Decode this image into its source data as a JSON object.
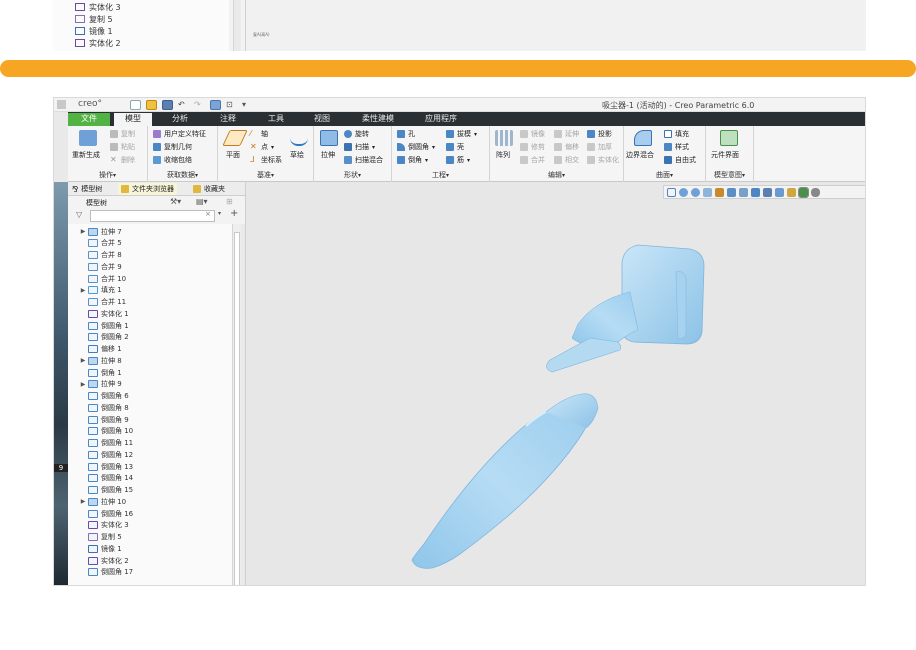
{
  "top_strip": {
    "tree_items": [
      {
        "label": "实体化 3",
        "icon": "solidify-icon",
        "color": "#6a4aa5"
      },
      {
        "label": "复制 5",
        "icon": "copy-icon",
        "color": "#8a6ab5"
      },
      {
        "label": "镜像 1",
        "icon": "mirror-icon",
        "color": "#3d6fb0"
      },
      {
        "label": "实体化 2",
        "icon": "solidify-icon",
        "color": "#6a4aa5"
      }
    ],
    "canvas_note": "复A(高A)"
  },
  "window": {
    "logo": "creo°",
    "title": "吸尘器-1 (活动的) - Creo Parametric 6.0"
  },
  "ribbon": {
    "tabs": [
      "文件",
      "模型",
      "分析",
      "注释",
      "工具",
      "视图",
      "柔性建模",
      "应用程序"
    ],
    "active_tab": "模型",
    "groups": {
      "operations": {
        "label": "操作",
        "regen": "重新生成",
        "copy": "复制",
        "paste": "粘贴",
        "delete": "删除"
      },
      "get_data": {
        "label": "获取数据",
        "udf": "用户定义特征",
        "copy_geom": "复制几何",
        "shrinkwrap": "收缩包络"
      },
      "datum": {
        "label": "基准",
        "plane": "平面",
        "axis": "轴",
        "point": "点",
        "csys": "坐标系",
        "sketch": "草绘"
      },
      "shapes": {
        "label": "形状",
        "extrude": "拉伸",
        "revolve": "旋转",
        "sweep": "扫描",
        "swept_blend": "扫描混合"
      },
      "engineering": {
        "label": "工程",
        "hole": "孔",
        "round": "倒圆角",
        "chamfer": "倒角",
        "draft": "拔模",
        "shell": "壳",
        "rib": "筋"
      },
      "editing": {
        "label": "编辑",
        "pattern": "阵列",
        "mirror": "镜像",
        "extend": "延伸",
        "project": "投影",
        "trim": "修剪",
        "offset": "偏移",
        "thicken": "加厚",
        "merge": "合并",
        "intersect": "相交",
        "solidify": "实体化"
      },
      "surfaces": {
        "label": "曲面",
        "boundary_blend": "边界混合",
        "fill": "填充",
        "style": "样式",
        "freestyle": "自由式"
      },
      "model_intent": {
        "label": "模型意图",
        "component_interface": "元件界面"
      }
    }
  },
  "navigator": {
    "tabs": [
      "模型树",
      "文件夹浏览器",
      "收藏夹"
    ],
    "header": "模型树",
    "filter_placeholder": "",
    "items": [
      {
        "label": "拉伸 7",
        "icon": "extrude-icon",
        "expandable": true,
        "color": "#4b86c5"
      },
      {
        "label": "合并 5",
        "icon": "merge-icon",
        "expandable": false,
        "color": "#5c8fc8"
      },
      {
        "label": "合并 8",
        "icon": "merge-icon",
        "expandable": false,
        "color": "#5c8fc8"
      },
      {
        "label": "合并 9",
        "icon": "merge-icon",
        "expandable": false,
        "color": "#5c8fc8"
      },
      {
        "label": "合并 10",
        "icon": "merge-icon",
        "expandable": false,
        "color": "#5c8fc8"
      },
      {
        "label": "填充 1",
        "icon": "fill-icon",
        "expandable": true,
        "color": "#4a9bd6"
      },
      {
        "label": "合并 11",
        "icon": "merge-icon",
        "expandable": false,
        "color": "#5c8fc8"
      },
      {
        "label": "实体化 1",
        "icon": "solidify-icon",
        "expandable": false,
        "color": "#6a4aa5"
      },
      {
        "label": "倒圆角 1",
        "icon": "round-icon",
        "expandable": false,
        "color": "#4b86c5"
      },
      {
        "label": "倒圆角 2",
        "icon": "round-icon",
        "expandable": false,
        "color": "#4b86c5"
      },
      {
        "label": "偏移 1",
        "icon": "offset-icon",
        "expandable": false,
        "color": "#3f7fb8"
      },
      {
        "label": "拉伸 8",
        "icon": "extrude-icon",
        "expandable": true,
        "color": "#4b86c5"
      },
      {
        "label": "倒角 1",
        "icon": "chamfer-icon",
        "expandable": false,
        "color": "#4b86c5"
      },
      {
        "label": "拉伸 9",
        "icon": "extrude-icon",
        "expandable": true,
        "color": "#4b86c5"
      },
      {
        "label": "倒圆角 6",
        "icon": "round-icon",
        "expandable": false,
        "color": "#4b86c5"
      },
      {
        "label": "倒圆角 8",
        "icon": "round-icon",
        "expandable": false,
        "color": "#4b86c5"
      },
      {
        "label": "倒圆角 9",
        "icon": "round-icon",
        "expandable": false,
        "color": "#4b86c5"
      },
      {
        "label": "倒圆角 10",
        "icon": "round-icon",
        "expandable": false,
        "color": "#4b86c5"
      },
      {
        "label": "倒圆角 11",
        "icon": "round-icon",
        "expandable": false,
        "color": "#4b86c5"
      },
      {
        "label": "倒圆角 12",
        "icon": "round-icon",
        "expandable": false,
        "color": "#4b86c5"
      },
      {
        "label": "倒圆角 13",
        "icon": "round-icon",
        "expandable": false,
        "color": "#4b86c5"
      },
      {
        "label": "倒圆角 14",
        "icon": "round-icon",
        "expandable": false,
        "color": "#4b86c5"
      },
      {
        "label": "倒圆角 15",
        "icon": "round-icon",
        "expandable": false,
        "color": "#4b86c5"
      },
      {
        "label": "拉伸 10",
        "icon": "extrude-icon",
        "expandable": true,
        "color": "#4b86c5"
      },
      {
        "label": "倒圆角 16",
        "icon": "round-icon",
        "expandable": false,
        "color": "#4b86c5"
      },
      {
        "label": "实体化 3",
        "icon": "solidify-icon",
        "expandable": false,
        "color": "#6a4aa5"
      },
      {
        "label": "复制 5",
        "icon": "copy-icon",
        "expandable": false,
        "color": "#8a6ab5"
      },
      {
        "label": "镜像 1",
        "icon": "mirror-icon",
        "expandable": false,
        "color": "#3d6fb0"
      },
      {
        "label": "实体化 2",
        "icon": "solidify-icon",
        "expandable": false,
        "color": "#6a4aa5"
      },
      {
        "label": "倒圆角 17",
        "icon": "round-icon",
        "expandable": false,
        "color": "#4b86c5"
      }
    ]
  },
  "wallpaper_number": "9",
  "colors": {
    "accent_orange": "#f6a623",
    "file_tab": "#52b244",
    "model_fill": "#a9d3ef",
    "ribbon_dark": "#2a2f33"
  }
}
